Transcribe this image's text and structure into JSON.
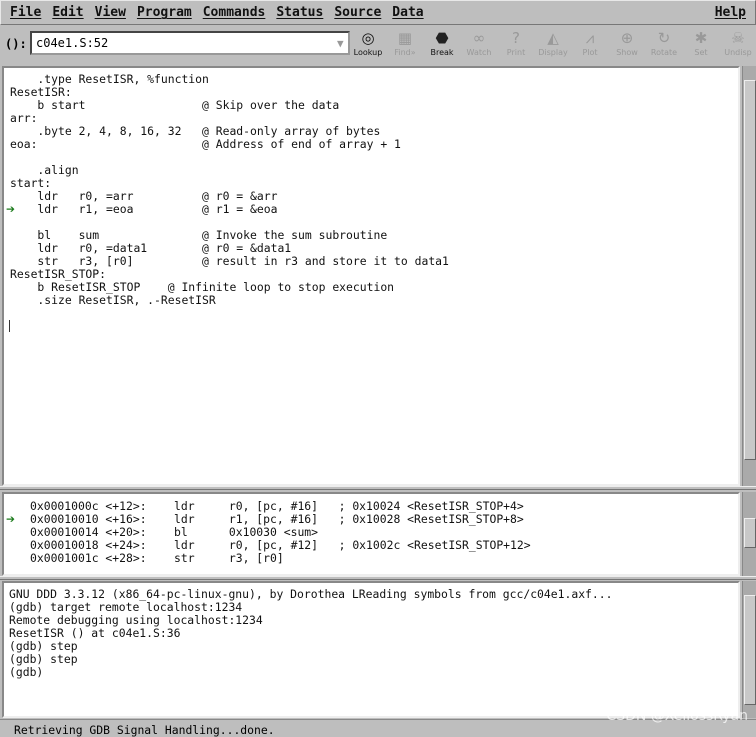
{
  "menu": [
    "File",
    "Edit",
    "View",
    "Program",
    "Commands",
    "Status",
    "Source",
    "Data"
  ],
  "help": "Help",
  "arg": {
    "label": "():",
    "value": "c04e1.S:52"
  },
  "toolbar": [
    {
      "label": "Lookup",
      "icon": "lookup-icon",
      "enabled": true
    },
    {
      "label": "Find»",
      "icon": "find-icon",
      "enabled": false
    },
    {
      "label": "Break",
      "icon": "stop-sign-icon",
      "enabled": true
    },
    {
      "label": "Watch",
      "icon": "glasses-icon",
      "enabled": false
    },
    {
      "label": "Print",
      "icon": "question-icon",
      "enabled": false
    },
    {
      "label": "Display",
      "icon": "display-icon",
      "enabled": false
    },
    {
      "label": "Plot",
      "icon": "plot-icon",
      "enabled": false
    },
    {
      "label": "Show",
      "icon": "magnifier-icon",
      "enabled": false
    },
    {
      "label": "Rotate",
      "icon": "rotate-icon",
      "enabled": false
    },
    {
      "label": "Set",
      "icon": "set-icon",
      "enabled": false
    },
    {
      "label": "Undisp",
      "icon": "skull-icon",
      "enabled": false
    }
  ],
  "source": {
    "lines": [
      "    .type ResetISR, %function",
      "ResetISR:",
      "    b start                 @ Skip over the data",
      "arr:",
      "    .byte 2, 4, 8, 16, 32   @ Read-only array of bytes",
      "eoa:                        @ Address of end of array + 1",
      "",
      "    .align",
      "start:",
      "    ldr   r0, =arr          @ r0 = &arr",
      "    ldr   r1, =eoa          @ r1 = &eoa",
      "",
      "    bl    sum               @ Invoke the sum subroutine",
      "    ldr   r0, =data1        @ r0 = &data1",
      "    str   r3, [r0]          @ result in r3 and store it to data1",
      "ResetISR_STOP:",
      "    b ResetISR_STOP    @ Infinite loop to stop execution",
      "    .size ResetISR, .-ResetISR"
    ],
    "current_line": 11
  },
  "disasm": {
    "lines": [
      "0x0001000c <+12>:    ldr     r0, [pc, #16]   ; 0x10024 <ResetISR_STOP+4>",
      "0x00010010 <+16>:    ldr     r1, [pc, #16]   ; 0x10028 <ResetISR_STOP+8>",
      "0x00010014 <+20>:    bl      0x10030 <sum>",
      "0x00010018 <+24>:    ldr     r0, [pc, #12]   ; 0x1002c <ResetISR_STOP+12>",
      "0x0001001c <+28>:    str     r3, [r0]"
    ],
    "current_line": 2
  },
  "console": {
    "lines": [
      "GNU DDD 3.3.12 (x86_64-pc-linux-gnu), by Dorothea LReading symbols from gcc/c04e1.axf...",
      "(gdb) target remote localhost:1234",
      "Remote debugging using localhost:1234",
      "ResetISR () at c04e1.S:36",
      "(gdb) step",
      "(gdb) step",
      "(gdb) "
    ]
  },
  "status": "Retrieving GDB Signal Handling...done.",
  "watermark": "CSDN @XellossRyan"
}
